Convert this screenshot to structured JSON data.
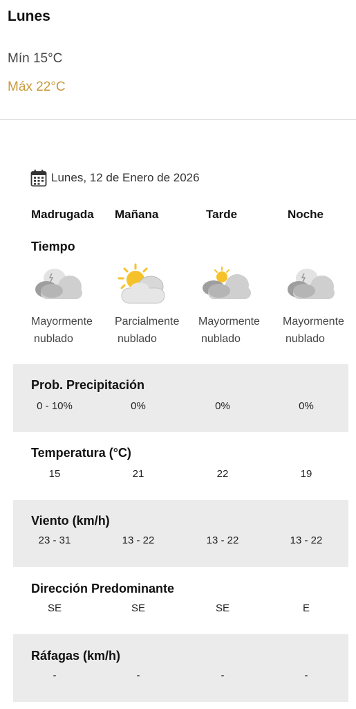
{
  "summary": {
    "day": "Lunes",
    "min": "Mín 15°C",
    "max": "Máx 22°C",
    "max_color": "#c99a3c"
  },
  "forecast": {
    "date": "Lunes, 12 de Enero de 2026",
    "periods": [
      "Madrugada",
      "Mañana",
      "Tarde",
      "Noche"
    ],
    "tiempo_label": "Tiempo",
    "conditions": [
      {
        "icon": "cloudy-night-icon",
        "line1": "Mayormente",
        "line2": "nublado"
      },
      {
        "icon": "partly-sunny-icon",
        "line1": "Parcialmente",
        "line2": "nublado"
      },
      {
        "icon": "mostly-cloudy-sun-icon",
        "line1": "Mayormente",
        "line2": "nublado"
      },
      {
        "icon": "cloudy-night-icon",
        "line1": "Mayormente",
        "line2": "nublado"
      }
    ],
    "rows": [
      {
        "title": "Prob. Precipitación",
        "values": [
          "0 - 10%",
          "0%",
          "0%",
          "0%"
        ]
      },
      {
        "title": "Temperatura (°C)",
        "values": [
          "15",
          "21",
          "22",
          "19"
        ]
      },
      {
        "title": "Viento (km/h)",
        "values": [
          "23 - 31",
          "13 - 22",
          "13 - 22",
          "13 - 22"
        ]
      },
      {
        "title": "Dirección Predominante",
        "values": [
          "SE",
          "SE",
          "SE",
          "E"
        ]
      },
      {
        "title": "Ráfagas (km/h)",
        "values": [
          "-",
          "-",
          "-",
          "-"
        ]
      }
    ]
  },
  "colors": {
    "shaded_row": "#ebebeb",
    "sun": "#f6c22b",
    "cloud": "#d3d3d3"
  }
}
